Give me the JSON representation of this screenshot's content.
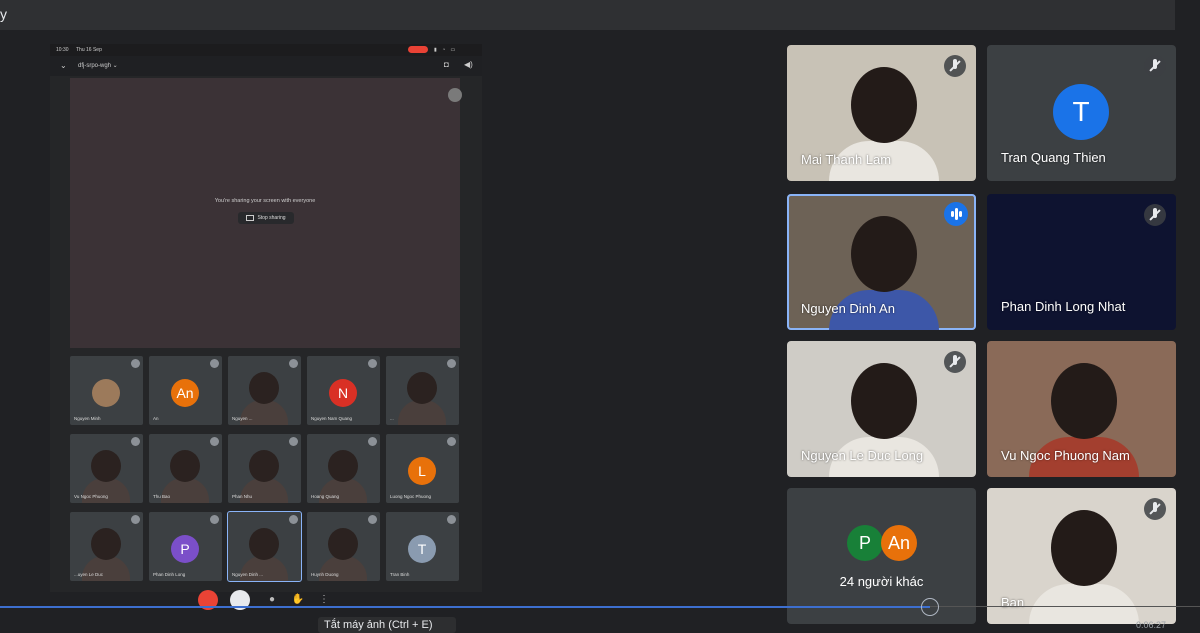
{
  "window": {
    "title_fragment": "y"
  },
  "phone": {
    "status_time": "10:30",
    "status_date": "Thu 16 Sep",
    "meeting_code": "dfj-srpo-wgh ⌄",
    "share_message": "You're sharing your screen with everyone",
    "stop_sharing_label": "Stop sharing",
    "participants": [
      {
        "name": "Nguyen Minh",
        "avatar": "",
        "color": "#9c7a5b"
      },
      {
        "name": "An",
        "avatar": "An",
        "color": "#e8710a"
      },
      {
        "name": "Nguyen ...",
        "avatar": "",
        "color": ""
      },
      {
        "name": "Nguyen Nam Quang",
        "avatar": "N",
        "color": "#d93025"
      },
      {
        "name": "...",
        "avatar": "",
        "color": ""
      },
      {
        "name": "Vu Ngoc Phuong",
        "avatar": "",
        "color": ""
      },
      {
        "name": "Thu Bao",
        "avatar": "",
        "color": ""
      },
      {
        "name": "Phan Nhu",
        "avatar": "",
        "color": ""
      },
      {
        "name": "Hoang Quang",
        "avatar": "",
        "color": ""
      },
      {
        "name": "Luong Ngoc Phuong",
        "avatar": "L",
        "color": "#e8710a"
      },
      {
        "name": "...uyen Le Duc",
        "avatar": "",
        "color": ""
      },
      {
        "name": "Phan Dinh Long",
        "avatar": "P",
        "color": "#7b4fc9"
      },
      {
        "name": "Nguyen Dinh ...",
        "avatar": "",
        "color": ""
      },
      {
        "name": "Huynh Duong",
        "avatar": "",
        "color": ""
      },
      {
        "name": "Tran Binh",
        "avatar": "T",
        "color": "#8a9bb0"
      }
    ]
  },
  "grid": {
    "tiles": [
      {
        "name": "Mai Thanh Lam",
        "type": "video",
        "muted": true,
        "speaking": false
      },
      {
        "name": "Tran Quang Thien",
        "type": "avatar",
        "avatar": "T",
        "muted": true,
        "speaking": false
      },
      {
        "name": "Nguyen Dinh An",
        "type": "video",
        "muted": false,
        "speaking": true
      },
      {
        "name": "Phan Dinh Long Nhat",
        "type": "dark",
        "muted": true,
        "speaking": false
      },
      {
        "name": "Nguyen Le Duc Long",
        "type": "video",
        "muted": true,
        "speaking": false
      },
      {
        "name": "Vu Ngoc Phuong Nam",
        "type": "video",
        "muted": false,
        "speaking": false
      },
      {
        "name": "24 người khác",
        "type": "others",
        "avatars": [
          "P",
          "An"
        ]
      },
      {
        "name": "Ban",
        "type": "video",
        "muted": true,
        "speaking": false
      }
    ]
  },
  "player": {
    "tooltip": "Tắt máy ảnh (Ctrl + E)",
    "timecode": "0:06:27",
    "progress": 0.775
  },
  "colors": {
    "accent": "#1a73e8",
    "speaking_border": "#8ab4f8",
    "avatar_orange": "#e8710a",
    "avatar_green": "#188038"
  }
}
